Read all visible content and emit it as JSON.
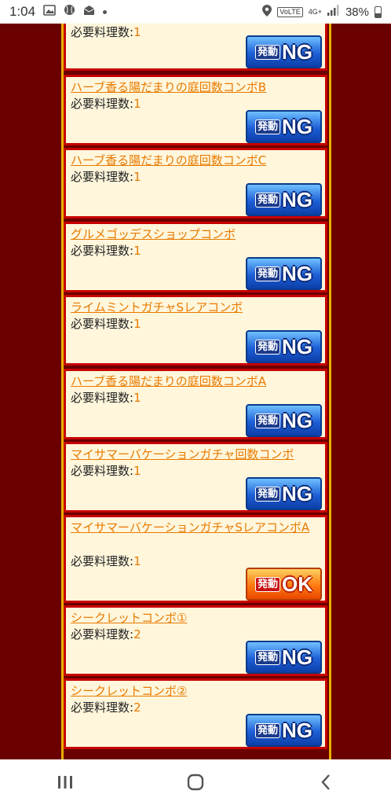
{
  "status_bar": {
    "time": "1:04",
    "network": "4G+",
    "volte": "VoLTE",
    "battery": "38%"
  },
  "combos": [
    {
      "name": "",
      "req_label": "必要料理数:",
      "req_value": "1",
      "badge_small": "発動",
      "badge_big": "NG",
      "status": "ng"
    },
    {
      "name": "ハーブ香る陽だまりの庭回数コンボB",
      "req_label": "必要料理数:",
      "req_value": "1",
      "badge_small": "発動",
      "badge_big": "NG",
      "status": "ng"
    },
    {
      "name": "ハーブ香る陽だまりの庭回数コンボC",
      "req_label": "必要料理数:",
      "req_value": "1",
      "badge_small": "発動",
      "badge_big": "NG",
      "status": "ng"
    },
    {
      "name": "グルメゴッデスショップコンボ",
      "req_label": "必要料理数:",
      "req_value": "1",
      "badge_small": "発動",
      "badge_big": "NG",
      "status": "ng"
    },
    {
      "name": "ライムミントガチャSレアコンボ",
      "req_label": "必要料理数:",
      "req_value": "1",
      "badge_small": "発動",
      "badge_big": "NG",
      "status": "ng"
    },
    {
      "name": "ハーブ香る陽だまりの庭回数コンボA",
      "req_label": "必要料理数:",
      "req_value": "1",
      "badge_small": "発動",
      "badge_big": "NG",
      "status": "ng"
    },
    {
      "name": "マイサマーバケーションガチャ回数コンボ",
      "req_label": "必要料理数:",
      "req_value": "1",
      "badge_small": "発動",
      "badge_big": "NG",
      "status": "ng"
    },
    {
      "name": "マイサマーバケーションガチャSレアコンボA",
      "req_label": "必要料理数:",
      "req_value": "1",
      "badge_small": "発動",
      "badge_big": "OK",
      "status": "ok"
    },
    {
      "name": "シークレットコンボ①",
      "req_label": "必要料理数:",
      "req_value": "2",
      "badge_small": "発動",
      "badge_big": "NG",
      "status": "ng"
    },
    {
      "name": "シークレットコンボ②",
      "req_label": "必要料理数:",
      "req_value": "2",
      "badge_small": "発動",
      "badge_big": "NG",
      "status": "ng"
    }
  ],
  "colors": {
    "background": "#6b0000",
    "card": "#fff6dc",
    "card_border": "#c80000",
    "link": "#e87a00",
    "panel_border": "#e8b000"
  }
}
